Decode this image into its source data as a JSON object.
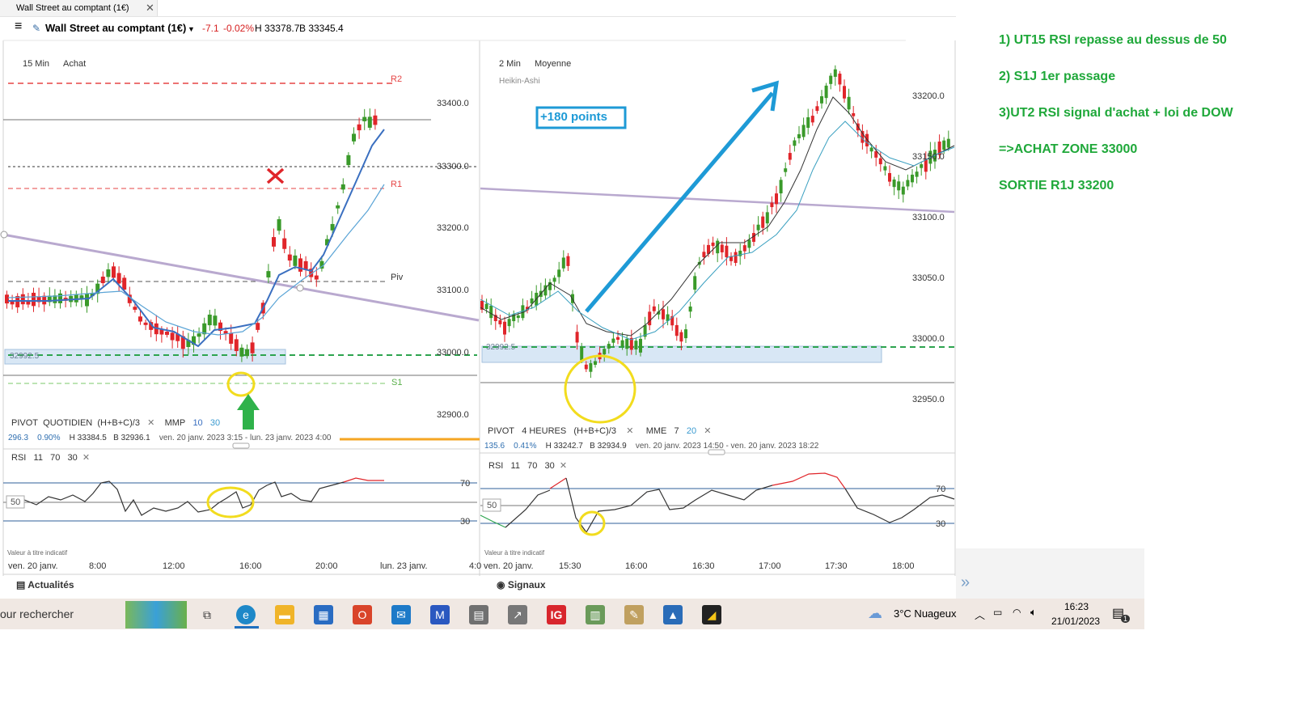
{
  "window": {
    "tab_title": "Wall Street au comptant (1€)",
    "tab_close": "✕"
  },
  "header": {
    "menu_icon": "≡",
    "instrument": "Wall Street au comptant (1€)",
    "change": "-7.1",
    "change_pct": "-0.02%",
    "high": "H 33378.7",
    "low": "B 33345.4"
  },
  "left_chart": {
    "timeframe": "15 Min",
    "mode": "Achat",
    "levels": {
      "r2": "R2",
      "r1": "R1",
      "piv": "Piv",
      "s1": "S1"
    },
    "zone_label": "32992.5",
    "price_axis": [
      "33400.0",
      "33300.0",
      "33200.0",
      "33100.0",
      "33000.0",
      "32900.0"
    ],
    "pivot_row": {
      "name": "PIVOT",
      "period": "QUOTIDIEN",
      "formula": "(H+B+C)/3",
      "close": "✕",
      "ma_name": "MMP",
      "ma1": "10",
      "ma2": "30"
    },
    "stats_row": {
      "value": "296.3",
      "pct": "0.90%",
      "high": "H 33384.5",
      "low": "B 32936.1",
      "range": "ven. 20 janv. 2023 3:15 - lun. 23 janv. 2023 4:00"
    },
    "rsi": {
      "name": "RSI",
      "p1": "11",
      "p2": "70",
      "p3": "30",
      "close": "✕",
      "l70": "70",
      "l50": "50",
      "l30": "30"
    },
    "disclaimer": "Valeur à titre indicatif",
    "time_axis": [
      "ven. 20 janv.",
      "8:00",
      "12:00",
      "16:00",
      "20:00",
      "lun. 23 janv.",
      "4:0"
    ],
    "bottom_tab": "Actualités"
  },
  "right_chart": {
    "timeframe": "2 Min",
    "mode": "Moyenne",
    "chart_type": "Heikin-Ashi",
    "callout": "+180 points",
    "zone_label": "32992.5",
    "price_axis": [
      "33200.0",
      "33150.0",
      "33100.0",
      "33050.0",
      "33000.0",
      "32950.0"
    ],
    "pivot_row": {
      "name": "PIVOT",
      "period": "4 HEURES",
      "formula": "(H+B+C)/3",
      "close": "✕",
      "ma_name": "MME",
      "ma1": "7",
      "ma2": "20"
    },
    "stats_row": {
      "value": "135.6",
      "pct": "0.41%",
      "high": "H 33242.7",
      "low": "B 32934.9",
      "range": "ven. 20 janv. 2023 14:50 - ven. 20 janv. 2023 18:22"
    },
    "rsi": {
      "name": "RSI",
      "p1": "11",
      "p2": "70",
      "p3": "30",
      "close": "✕",
      "l70": "70",
      "l50": "50",
      "l30": "30"
    },
    "disclaimer": "Valeur à titre indicatif",
    "time_axis": [
      "ven. 20 janv.",
      "15:30",
      "16:00",
      "16:30",
      "17:00",
      "17:30",
      "18:00"
    ],
    "bottom_tab": "Signaux",
    "expand": "»"
  },
  "annotations": [
    "1) UT15  RSI repasse au dessus de 50",
    "2) S1J 1er passage",
    "3)UT2 RSI signal d'achat + loi de DOW",
    "=>ACHAT ZONE 33000",
    "SORTIE R1J 33200"
  ],
  "taskbar": {
    "search": "our rechercher",
    "weather": "3°C  Nuageux",
    "time": "16:23",
    "date": "21/01/2023",
    "notif_count": "1"
  },
  "colors": {
    "bull": "#3a9a2a",
    "bear": "#e0252a",
    "accent_blue": "#1e9ad6",
    "annot_green": "#1fa83a"
  }
}
